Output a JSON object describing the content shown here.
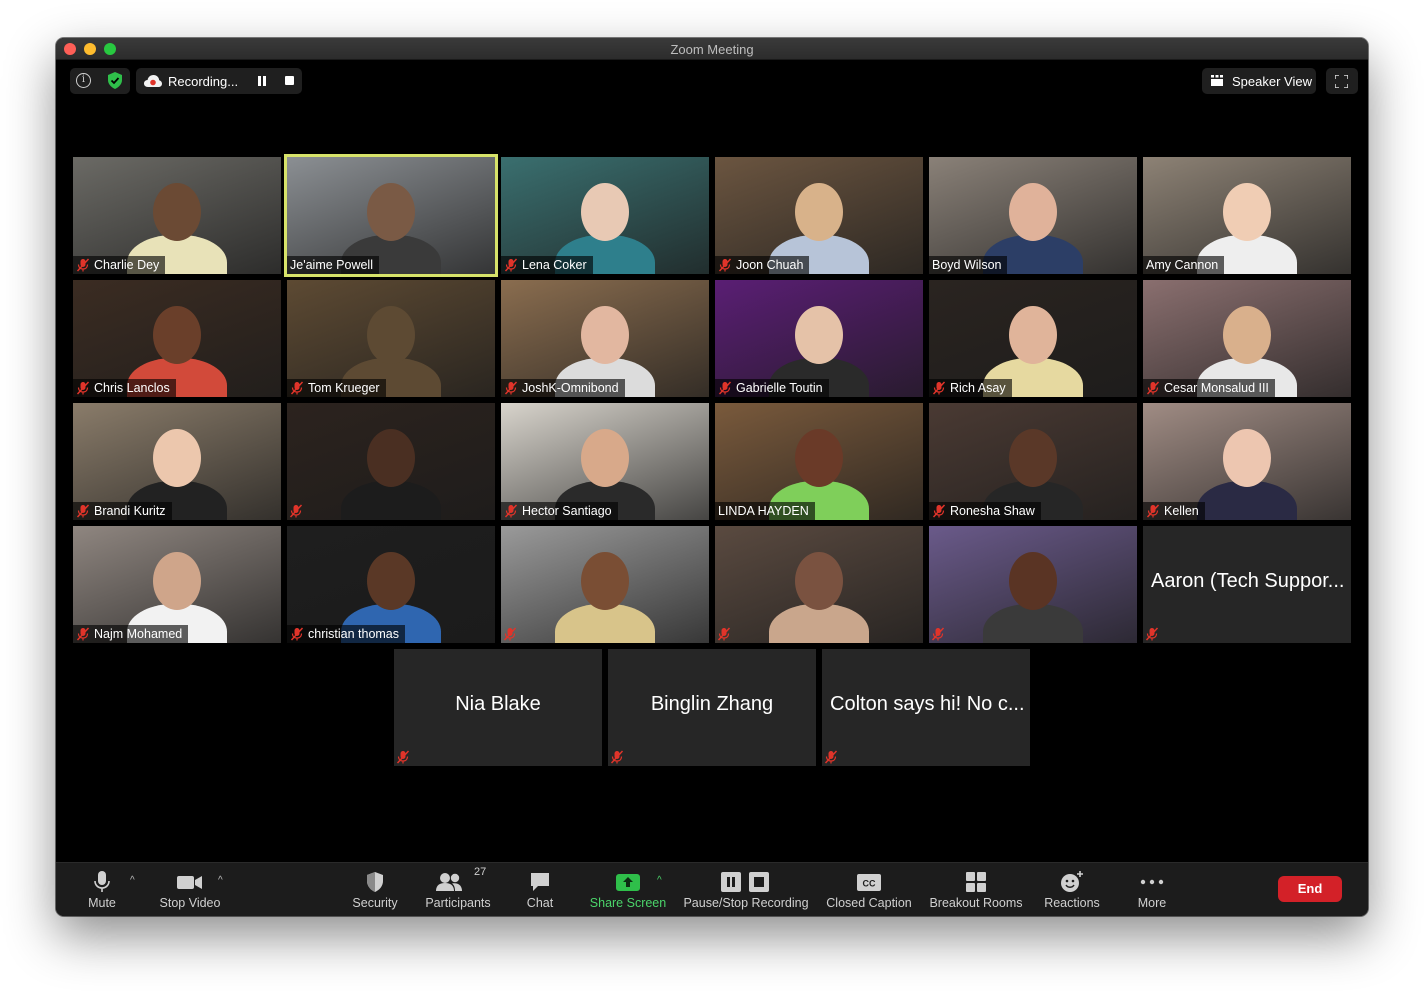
{
  "window": {
    "title": "Zoom Meeting"
  },
  "topbar": {
    "recording_label": "Recording...",
    "view_label": "Speaker View"
  },
  "participants": [
    {
      "name": "Charlie Dey",
      "muted": true,
      "bg": "#6b6a65",
      "skin": "#6b4a34",
      "shirt": "#e8e2b8"
    },
    {
      "name": "Je'aime Powell",
      "muted": false,
      "active": true,
      "bg": "#8b8f93",
      "skin": "#7a5a45",
      "shirt": "#3a3a3a"
    },
    {
      "name": "Lena Coker",
      "muted": true,
      "bg": "#3a6f6f",
      "skin": "#e8c9b4",
      "shirt": "#2e7f8c"
    },
    {
      "name": "Joon Chuah",
      "muted": true,
      "bg": "#6b5540",
      "skin": "#d8b28a",
      "shirt": "#b7c4d8"
    },
    {
      "name": "Boyd Wilson",
      "muted": false,
      "bg": "#8a8178",
      "skin": "#e0b29a",
      "shirt": "#2c3e66"
    },
    {
      "name": "Amy Cannon",
      "muted": false,
      "bg": "#8d8275",
      "skin": "#f0cdb4",
      "shirt": "#eeeeee"
    },
    {
      "name": "Chris Lanclos",
      "muted": true,
      "bg": "#3b2c22",
      "skin": "#6a3f2a",
      "shirt": "#d24a3a"
    },
    {
      "name": "Tom Krueger",
      "muted": true,
      "bg": "#5d4a33",
      "skin": "#5d4a33",
      "shirt": "#5d4a33"
    },
    {
      "name": "JoshK-Omnibond",
      "muted": true,
      "bg": "#8a6d4f",
      "skin": "#e2b7a0",
      "shirt": "#dcdcdc"
    },
    {
      "name": "Gabrielle Toutin",
      "muted": true,
      "bg": "#5a1e74",
      "skin": "#e5c2a8",
      "shirt": "#2a2a2a"
    },
    {
      "name": "Rich Asay",
      "muted": true,
      "bg": "#2a2420",
      "skin": "#e0b49a",
      "shirt": "#e6d9a0"
    },
    {
      "name": "Cesar Monsalud III",
      "muted": true,
      "bg": "#8a6f6f",
      "skin": "#d9b08c",
      "shirt": "#e8e8e8"
    },
    {
      "name": "Brandi Kuritz",
      "muted": true,
      "bg": "#8a7c6a",
      "skin": "#ecc7ad",
      "shirt": "#222222"
    },
    {
      "name": "",
      "muted": true,
      "bg": "#2c231e",
      "skin": "#4a2f22",
      "shirt": "#1c1c1c"
    },
    {
      "name": "Hector Santiago",
      "muted": true,
      "bg": "#d8d4cc",
      "skin": "#d8a98a",
      "shirt": "#2a2a2a"
    },
    {
      "name": "LINDA HAYDEN",
      "muted": false,
      "bg": "#7a5a3c",
      "skin": "#6a3a28",
      "shirt": "#7fcf5a"
    },
    {
      "name": "Ronesha Shaw",
      "muted": true,
      "bg": "#4a3a33",
      "skin": "#5a3828",
      "shirt": "#262626"
    },
    {
      "name": "Kellen",
      "muted": true,
      "bg": "#a08c84",
      "skin": "#edc6b0",
      "shirt": "#2a2a44"
    },
    {
      "name": "Najm Mohamed",
      "muted": true,
      "bg": "#8f8680",
      "skin": "#cfa58a",
      "shirt": "#f2f2f2"
    },
    {
      "name": "christian thomas",
      "muted": true,
      "bg": "#1e1e1e",
      "skin": "#5a3826",
      "shirt": "#2f66b0"
    },
    {
      "name": "",
      "muted": true,
      "bg": "#9a9a9a",
      "skin": "#7a4e34",
      "shirt": "#d8c48a"
    },
    {
      "name": "",
      "muted": true,
      "bg": "#5a4a40",
      "skin": "#7a5240",
      "shirt": "#c9a68c"
    },
    {
      "name": "",
      "muted": true,
      "bg": "#6a5a8a",
      "skin": "#5a3424",
      "shirt": "#3a3a3a"
    },
    {
      "name": "Aaron (Tech Suppor...",
      "muted": true,
      "video": false
    },
    {
      "name": "Nia Blake",
      "muted": true,
      "video": false
    },
    {
      "name": "Binglin Zhang",
      "muted": true,
      "video": false
    },
    {
      "name": "Colton says hi! No c...",
      "muted": true,
      "video": false
    }
  ],
  "toolbar": {
    "mute": "Mute",
    "stop_video": "Stop Video",
    "security": "Security",
    "participants": "Participants",
    "participants_count": "27",
    "chat": "Chat",
    "share_screen": "Share Screen",
    "pause_stop_recording": "Pause/Stop Recording",
    "closed_caption": "Closed Caption",
    "breakout_rooms": "Breakout Rooms",
    "reactions": "Reactions",
    "more": "More",
    "end": "End"
  },
  "colors": {
    "active_speaker": "#d7e36a",
    "share_green": "#4bd46a",
    "end_red": "#d32128",
    "muted_red": "#e0342a"
  }
}
